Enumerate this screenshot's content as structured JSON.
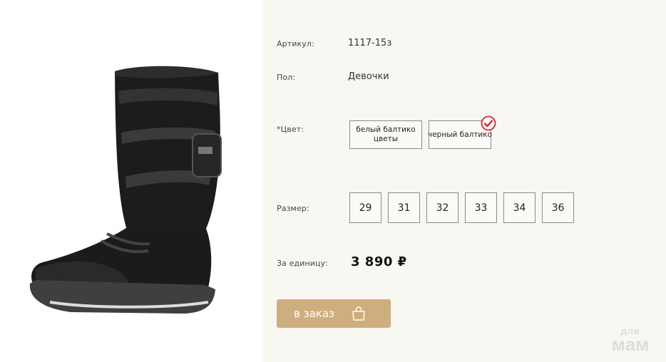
{
  "product": {
    "sku_label": "Артикул:",
    "sku_value": "1117-15з",
    "gender_label": "Пол:",
    "gender_value": "Девочки",
    "color_label": "*Цвет:",
    "colors": [
      {
        "label": "белый балтико цветы",
        "selected": false
      },
      {
        "label": "черный балтико",
        "selected": true
      }
    ],
    "size_label": "Размер:",
    "sizes": [
      "29",
      "31",
      "32",
      "33",
      "34",
      "36"
    ],
    "price_label": "За единицу:",
    "price_value": "3 890 ₽",
    "order_button_label": "в заказ"
  },
  "watermark": {
    "line1": "для",
    "line2": "мам"
  },
  "colors": {
    "panel_bg": "#f9f7f2",
    "button_bg": "#cfae7e",
    "check_red": "#e2202a"
  },
  "icons": {
    "selected_check": "check-circle-icon",
    "order": "shopping-bag-icon"
  }
}
